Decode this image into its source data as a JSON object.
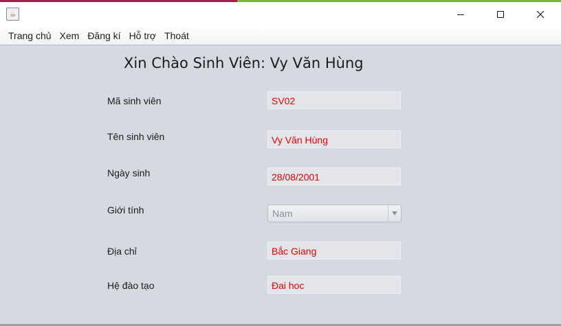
{
  "window": {
    "icon": "java-app-icon",
    "controls": [
      "minimize-icon",
      "maximize-icon",
      "close-icon"
    ]
  },
  "menu": {
    "items": [
      {
        "label": "Trang chủ"
      },
      {
        "label": "Xem"
      },
      {
        "label": "Đăng kí"
      },
      {
        "label": "Hỗ trợ"
      },
      {
        "label": "Thoát"
      }
    ]
  },
  "greeting": "Xin Chào Sinh Viên: Vy Văn Hùng",
  "form": {
    "student_id": {
      "label": "Mã sinh viên",
      "value": "SV02"
    },
    "student_name": {
      "label": "Tên sinh viên",
      "value": "Vy Văn Hùng"
    },
    "birth_date": {
      "label": "Ngày sinh",
      "value": "28/08/2001"
    },
    "gender": {
      "label": "Giới tính",
      "value": "Nam"
    },
    "address": {
      "label": "Địa chỉ",
      "value": "Bắc Giang"
    },
    "education_type": {
      "label": "Hệ đào tạo",
      "value": "Đai hoc"
    }
  },
  "colors": {
    "background": "#d6d9df",
    "field_text": "#e60000",
    "field_background": "#e3e5ea"
  }
}
